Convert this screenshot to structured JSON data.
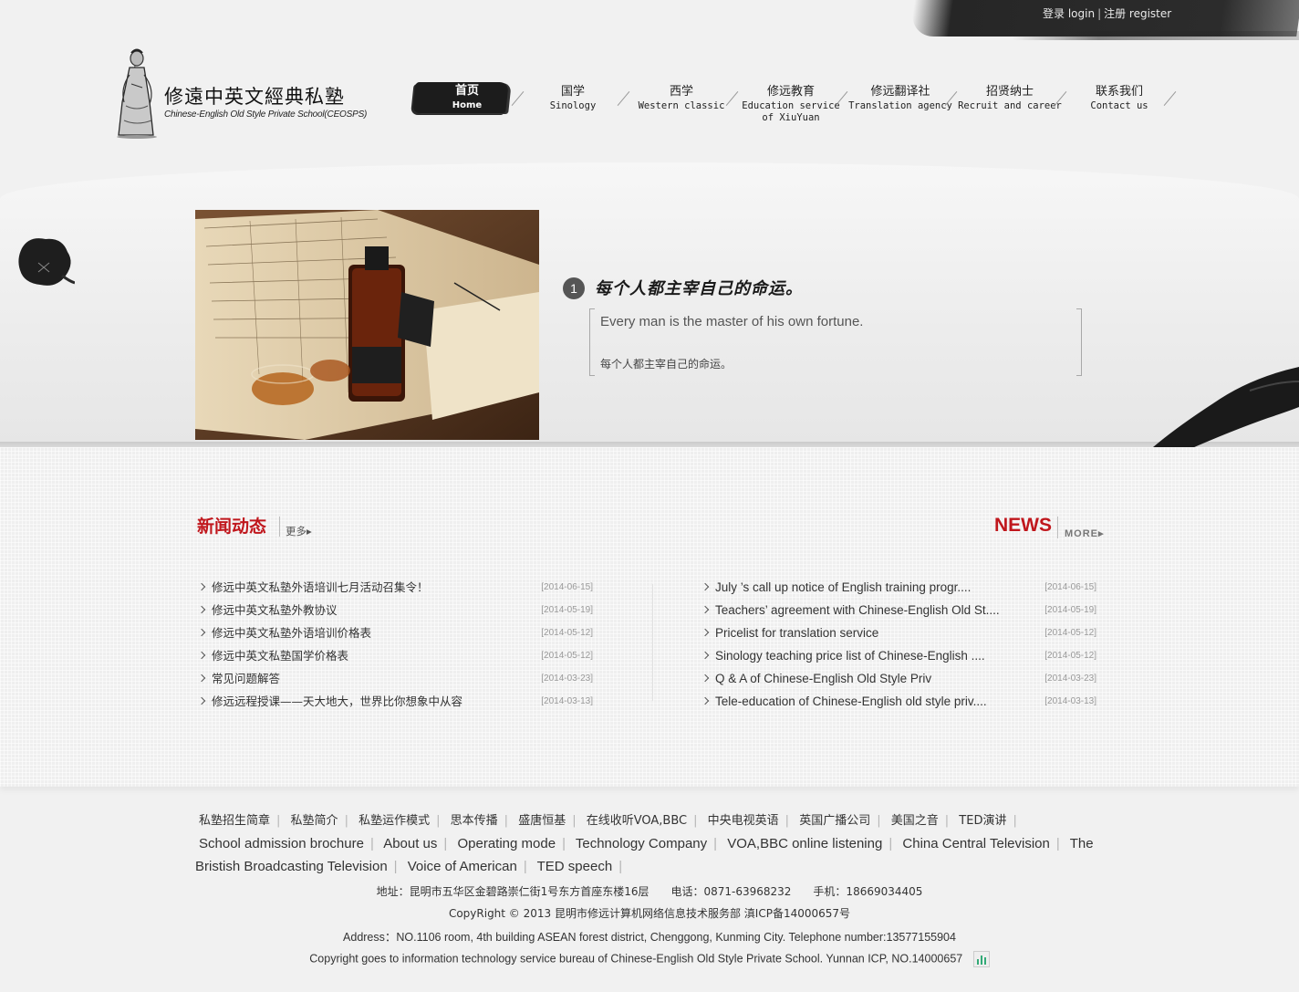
{
  "header": {
    "login": "登录 login",
    "register": "注册 register",
    "logo_cn": "修遠中英文經典私塾",
    "logo_en": "Chinese-English Old Style Private School(CEOSPS)"
  },
  "nav": [
    {
      "cn": "首页",
      "en": "Home"
    },
    {
      "cn": "国学",
      "en": "Sinology"
    },
    {
      "cn": "西学",
      "en": "Western classic"
    },
    {
      "cn": "修远教育",
      "en": "Education service",
      "en2": "of XiuYuan"
    },
    {
      "cn": "修远翻译社",
      "en": "Translation agency"
    },
    {
      "cn": "招贤纳士",
      "en": "Recruit and career"
    },
    {
      "cn": "联系我们",
      "en": "Contact us"
    }
  ],
  "banner": {
    "num": "1",
    "title": "每个人都主宰自己的命运。",
    "quote_en": "Every man is the master of his own fortune.",
    "quote_cn": "每个人都主宰自己的命运。"
  },
  "news_cn": {
    "title": "新闻动态",
    "more": "更多",
    "items": [
      {
        "text": "修远中英文私塾外语培训七月活动召集令！",
        "date": "[2014-06-15]"
      },
      {
        "text": "修远中英文私塾外教协议",
        "date": "[2014-05-19]"
      },
      {
        "text": "修远中英文私塾外语培训价格表",
        "date": "[2014-05-12]"
      },
      {
        "text": "修远中英文私塾国学价格表",
        "date": "[2014-05-12]"
      },
      {
        "text": "常见问题解答",
        "date": "[2014-03-23]"
      },
      {
        "text": "修远远程授课——天大地大，世界比你想象中从容",
        "date": "[2014-03-13]"
      }
    ]
  },
  "news_en": {
    "title": "NEWS",
    "more": "MORE",
    "items": [
      {
        "text": "July ’s call up notice of English training progr....",
        "date": "[2014-06-15]"
      },
      {
        "text": "Teachers’  agreement with Chinese-English Old St....",
        "date": "[2014-05-19]"
      },
      {
        "text": "Pricelist for translation service",
        "date": "[2014-05-12]"
      },
      {
        "text": "Sinology teaching price list of Chinese-English ....",
        "date": "[2014-05-12]"
      },
      {
        "text": "Q & A of Chinese-English Old Style Priv",
        "date": "[2014-03-23]"
      },
      {
        "text": "Tele-education of Chinese-English old style priv....",
        "date": "[2014-03-13]"
      }
    ]
  },
  "footer": {
    "links_cn": [
      "私塾招生简章",
      "私塾简介",
      "私塾运作模式",
      "思本传播",
      "盛唐恒基",
      "在线收听VOA,BBC",
      "中央电视英语",
      "英国广播公司",
      "美国之音",
      "TED演讲"
    ],
    "links_en_row1": [
      "School admission brochure",
      "About us",
      "Operating mode",
      "Technology Company",
      "VOA,BBC online listening",
      "China Central Television",
      "The"
    ],
    "links_en_row2": [
      "Bristish Broadcasting Television",
      "Voice of American",
      "TED speech"
    ],
    "address_cn": "地址：昆明市五华区金碧路崇仁街1号东方首座东楼16层　　电话：0871-63968232　　手机：18669034405",
    "copyright_cn": "CopyRight © 2013 昆明市修远计算机网络信息技术服务部 滇ICP备14000657号",
    "address_en": "Address：NO.1106 room, 4th building ASEAN forest district, Chenggong, Kunming City. Telephone number:13577155904",
    "copyright_en": "Copyright goes to information technology service bureau of Chinese-English Old Style Private School. Yunnan ICP, NO.14000657"
  }
}
